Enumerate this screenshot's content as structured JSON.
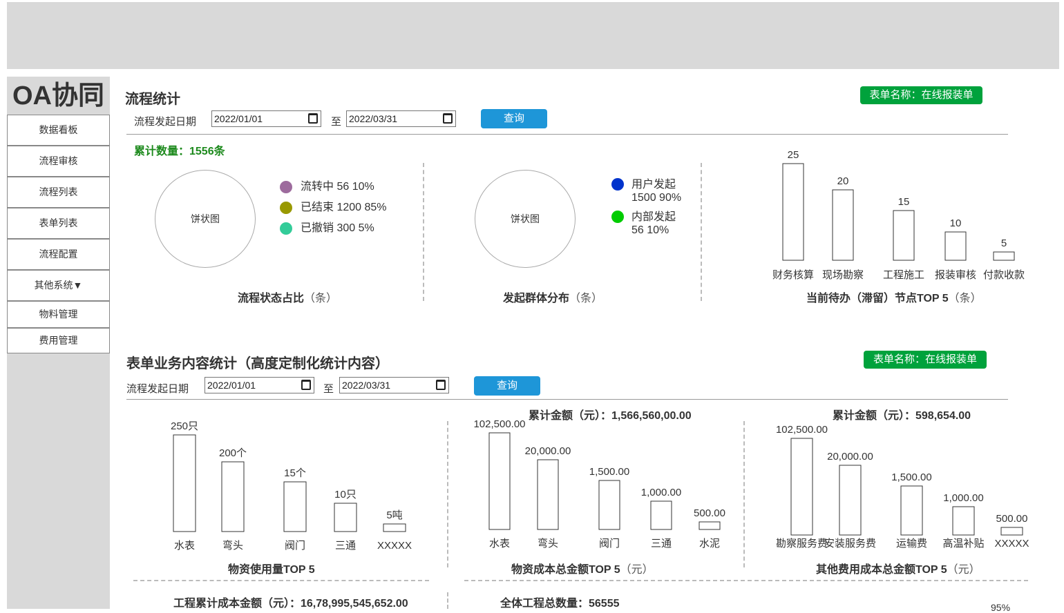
{
  "app": {
    "logo": "OA协同"
  },
  "nav": {
    "items": [
      "数据看板",
      "流程审核",
      "流程列表",
      "表单列表",
      "流程配置",
      "其他系统▼",
      "物料管理",
      "费用管理"
    ]
  },
  "section1": {
    "title": "流程统计",
    "form_badge": "表单名称：在线报装单",
    "date_label": "流程发起日期",
    "date_from": "2022/01/01",
    "to_label": "至",
    "date_to": "2022/03/31",
    "query_button": "查询",
    "total_count": "累计数量：1556条",
    "pie1": {
      "placeholder": "饼状图",
      "legend": [
        {
          "label": "流转中  56  10%",
          "color": "#9d6b9d"
        },
        {
          "label": "已结束  1200  85%",
          "color": "#999900"
        },
        {
          "label": "已撤销  300  5%",
          "color": "#33cc99"
        }
      ],
      "title": "流程状态占比",
      "unit": "（条）"
    },
    "pie2": {
      "placeholder": "饼状图",
      "legend": [
        {
          "label": "用户发起",
          "value": "1500  90%",
          "color": "#0033cc"
        },
        {
          "label": "内部发起",
          "value": "56  10%",
          "color": "#00cc00"
        }
      ],
      "title": "发起群体分布",
      "unit": "（条）"
    },
    "bar_title": "当前待办（滞留）节点TOP 5",
    "bar_unit": "（条）"
  },
  "section2": {
    "title": "表单业务内容统计（高度定制化统计内容）",
    "form_badge": "表单名称：在线报装单",
    "date_label": "流程发起日期",
    "date_from": "2022/01/01",
    "to_label": "至",
    "date_to": "2022/03/31",
    "query_button": "查询",
    "chart1_title": "物资使用量TOP 5",
    "chart2_sum": "累计金额（元）：1,566,560,00.00",
    "chart2_title": "物资成本总金额TOP 5",
    "chart2_unit": "（元）",
    "chart3_sum": "累计金额（元）：598,654.00",
    "chart3_title": "其他费用成本总金额TOP 5",
    "chart3_unit": "（元）",
    "bottom_left": "工程累计成本金额（元）：16,78,995,545,652.00",
    "bottom_mid": "全体工程总数量：56555",
    "bottom_right": "95%"
  },
  "chart_data": [
    {
      "type": "bar",
      "title": "当前待办（滞留）节点TOP 5",
      "categories": [
        "财务核算",
        "现场勘察",
        "工程施工",
        "报装审核",
        "付款收款"
      ],
      "values": [
        25,
        20,
        15,
        10,
        5
      ],
      "labels": [
        "25",
        "20",
        "15",
        "10",
        "5"
      ]
    },
    {
      "type": "bar",
      "title": "物资使用量TOP 5",
      "categories": [
        "水表",
        "弯头",
        "阀门",
        "三通",
        "XXXXX"
      ],
      "values": [
        250,
        200,
        15,
        10,
        5
      ],
      "labels": [
        "250只",
        "200个",
        "15个",
        "10只",
        "5吨"
      ]
    },
    {
      "type": "bar",
      "title": "物资成本总金额TOP 5",
      "categories": [
        "水表",
        "弯头",
        "阀门",
        "三通",
        "水泥"
      ],
      "values": [
        102500,
        20000,
        1500,
        1000,
        500
      ],
      "labels": [
        "102,500.00",
        "20,000.00",
        "1,500.00",
        "1,000.00",
        "500.00"
      ]
    },
    {
      "type": "bar",
      "title": "其他费用成本总金额TOP 5",
      "categories": [
        "勘察服务费",
        "安装服务费",
        "运输费",
        "高温补贴",
        "XXXXX"
      ],
      "values": [
        102500,
        20000,
        1500,
        1000,
        500
      ],
      "labels": [
        "102,500.00",
        "20,000.00",
        "1,500.00",
        "1,000.00",
        "500.00"
      ]
    }
  ]
}
